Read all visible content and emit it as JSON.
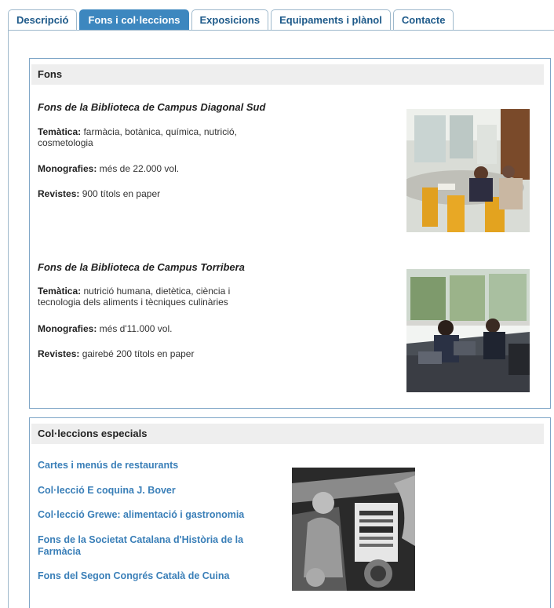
{
  "tabs": [
    {
      "label": "Descripció",
      "active": false
    },
    {
      "label": "Fons i col·leccions",
      "active": true
    },
    {
      "label": "Exposicions",
      "active": false
    },
    {
      "label": "Equipaments i plànol",
      "active": false
    },
    {
      "label": "Contacte",
      "active": false
    }
  ],
  "fons": {
    "heading": "Fons",
    "entries": [
      {
        "title": "Fons de la Biblioteca de Campus Diagonal Sud",
        "tematica_label": "Temàtica:",
        "tematica_value": " farmàcia, botànica, química, nutrició, cosmetologia",
        "monografies_label": "Monografies:",
        "monografies_value": " més de 22.000 vol.",
        "revistes_label": "Revistes:",
        "revistes_value": " 900 títols en paper",
        "photo_icon": "study-room-photo"
      },
      {
        "title": "Fons de la Biblioteca de Campus Torribera",
        "tematica_label": "Temàtica:",
        "tematica_value": " nutrició humana, dietètica, ciència i tecnologia dels aliments i tècniques culinàries",
        "monografies_label": "Monografies:",
        "monografies_value": " més d'11.000 vol.",
        "revistes_label": "Revistes:",
        "revistes_value": " gairebé 200 títols en paper",
        "photo_icon": "students-at-laptops-photo"
      }
    ]
  },
  "colleccions": {
    "heading": "Col·leccions especials",
    "links": [
      "Cartes i menús de restaurants",
      "Col·lecció E coquina J. Bover",
      "Col·lecció Grewe: alimentació i gastronomia",
      "Fons de la Societat Catalana d'Història de la Farmàcia",
      "Fons del Segon Congrés Català de Cuina"
    ],
    "engraving_icon": "antique-cookbook-engraving"
  },
  "colors": {
    "accent": "#3d87bf",
    "link": "#3a7fb8",
    "border": "#7fa6c7"
  }
}
